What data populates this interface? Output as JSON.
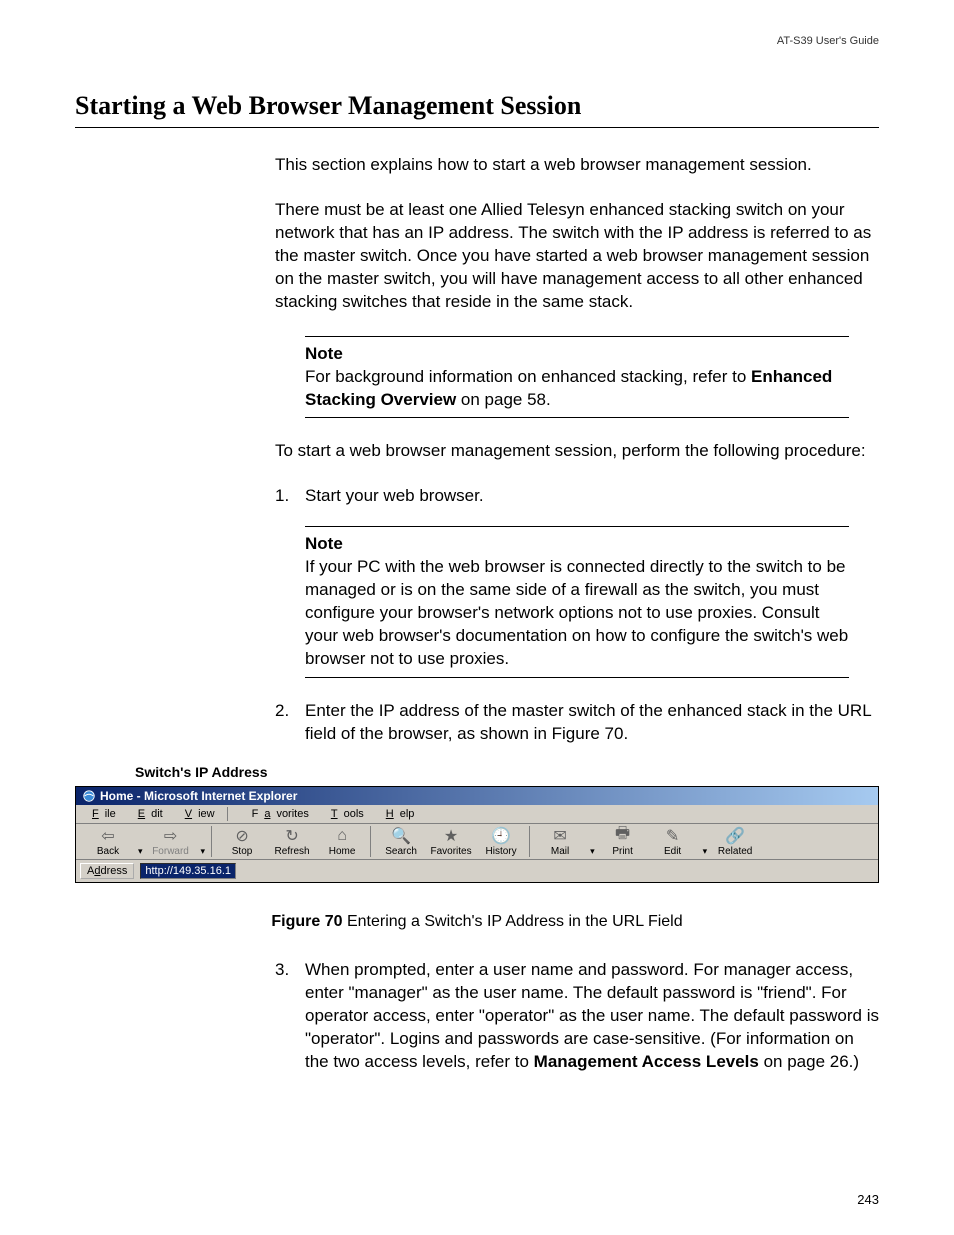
{
  "header": {
    "guide": "AT-S39 User's Guide"
  },
  "title": "Starting a Web Browser Management Session",
  "p1": "This section explains how to start a web browser management session.",
  "p2": "There must be at least one Allied Telesyn enhanced stacking switch on your network that has an IP address. The switch with the IP address is referred to as the master switch. Once you have started a web browser management session on the master switch, you will have management access to all other enhanced stacking switches that reside in the same stack.",
  "note1": {
    "label": "Note",
    "t1": "For background information on enhanced stacking, refer to ",
    "bold": "Enhanced Stacking Overview",
    "t2": " on page 58."
  },
  "p3": "To start a web browser management session, perform the following procedure:",
  "step1": {
    "num": "1.",
    "text": "Start your web browser."
  },
  "note2": {
    "label": "Note",
    "text": "If your PC with the web browser is connected directly to the switch to be managed or is on the same side of a firewall as the switch, you must configure your browser's network options not to use proxies. Consult your web browser's documentation on how to configure the switch's web browser not to use proxies."
  },
  "step2": {
    "num": "2.",
    "text": "Enter the IP address of the master switch of the enhanced stack in the URL field of the browser, as shown in Figure 70."
  },
  "figlabel": "Switch's IP Address",
  "browser": {
    "title": "Home - Microsoft Internet Explorer",
    "menu": {
      "file": "File",
      "edit": "Edit",
      "view": "View",
      "fav": "Favorites",
      "tools": "Tools",
      "help": "Help"
    },
    "tb": {
      "back": "Back",
      "forward": "Forward",
      "stop": "Stop",
      "refresh": "Refresh",
      "home": "Home",
      "search": "Search",
      "favorites": "Favorites",
      "history": "History",
      "mail": "Mail",
      "print": "Print",
      "edit2": "Edit",
      "related": "Related"
    },
    "addrlabel": "Address",
    "url": "http://149.35.16.1"
  },
  "figcap": {
    "num": "Figure 70",
    "text": "  Entering a Switch's IP Address in the URL Field"
  },
  "step3": {
    "num": "3.",
    "t1": "When prompted, enter a user name and password. For manager access, enter \"manager\" as the user name. The default password is \"friend\". For operator access, enter \"operator\" as the user name. The default password is \"operator\". Logins and passwords are case-sensitive. (For information on the two access levels, refer to ",
    "bold": "Management Access Levels",
    "t2": " on page 26.)"
  },
  "pagenum": "243"
}
